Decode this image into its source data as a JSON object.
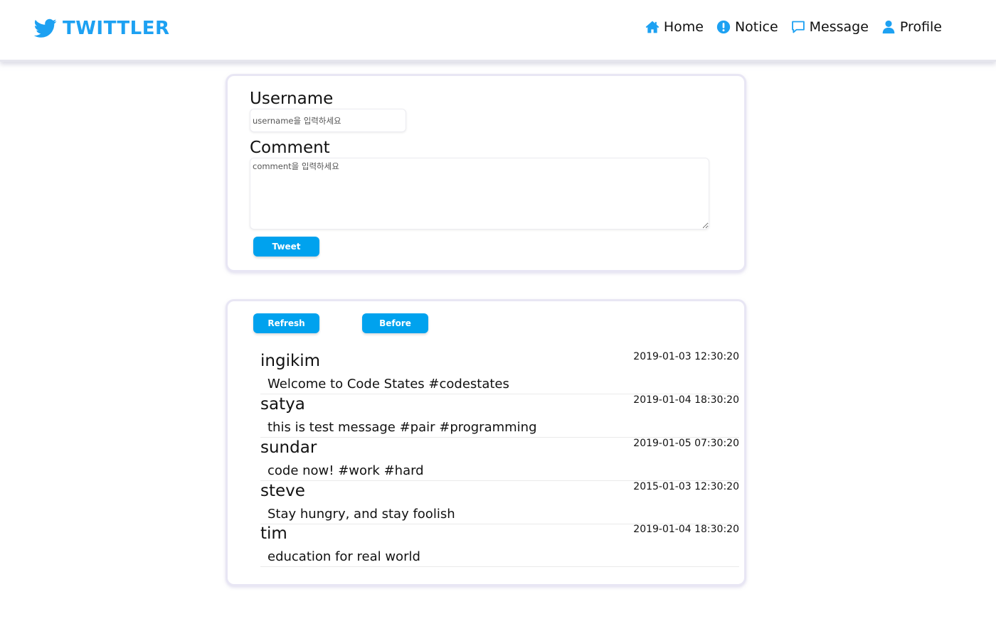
{
  "header": {
    "logo_text": "TWITTLER",
    "nav": [
      {
        "label": "Home",
        "icon": "home-icon"
      },
      {
        "label": "Notice",
        "icon": "exclamation-circle-icon"
      },
      {
        "label": "Message",
        "icon": "comment-icon"
      },
      {
        "label": "Profile",
        "icon": "user-icon"
      }
    ]
  },
  "form": {
    "username_label": "Username",
    "username_placeholder": "username을 입력하세요",
    "comment_label": "Comment",
    "comment_placeholder": "comment을 입력하세요",
    "tweet_button": "Tweet"
  },
  "feed": {
    "refresh_button": "Refresh",
    "before_button": "Before",
    "tweets": [
      {
        "user": "ingikim",
        "message": "Welcome to Code States #codestates",
        "created_at": "2019-01-03 12:30:20"
      },
      {
        "user": "satya",
        "message": "this is test message #pair #programming",
        "created_at": "2019-01-04 18:30:20"
      },
      {
        "user": "sundar",
        "message": "code now! #work #hard",
        "created_at": "2019-01-05 07:30:20"
      },
      {
        "user": "steve",
        "message": "Stay hungry, and stay foolish",
        "created_at": "2015-01-03 12:30:20"
      },
      {
        "user": "tim",
        "message": "education for real world",
        "created_at": "2019-01-04 18:30:20"
      }
    ]
  },
  "colors": {
    "brand": "#1da1f2",
    "button": "#00a2ee"
  }
}
